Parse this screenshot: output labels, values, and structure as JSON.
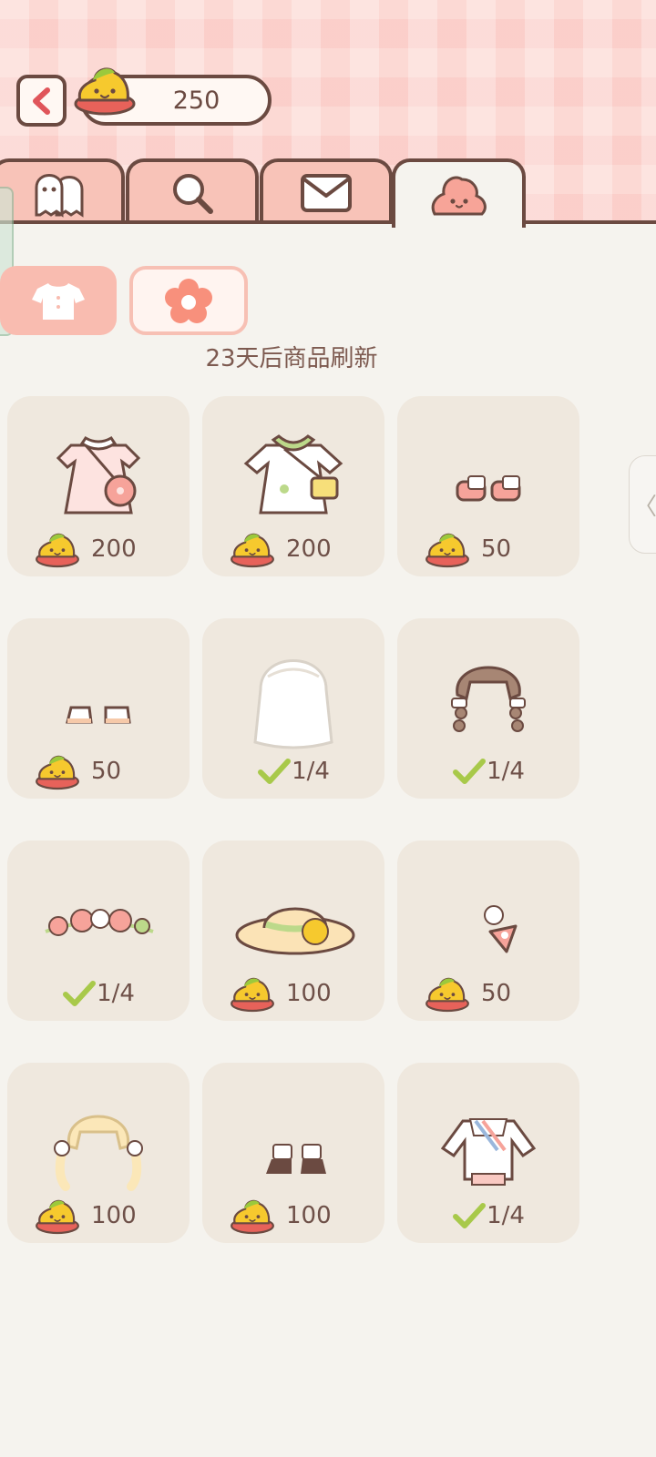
{
  "header": {
    "coin_count": "250",
    "back_icon": "back-arrow-icon",
    "currency_icon": "poop-coin-icon"
  },
  "tabs": [
    {
      "icon": "ghost-friends-icon",
      "active": false
    },
    {
      "icon": "magnifier-icon",
      "active": false
    },
    {
      "icon": "mail-icon",
      "active": false
    },
    {
      "icon": "pink-poop-icon",
      "active": true
    }
  ],
  "categories": [
    {
      "icon": "shirt-icon",
      "selected": true
    },
    {
      "icon": "flower-icon",
      "selected": false
    }
  ],
  "refresh_text": "23天后商品刷新",
  "items": [
    {
      "name": "pink-floral-dress",
      "label": "200",
      "owned": false
    },
    {
      "name": "green-dress-with-bag",
      "label": "200",
      "owned": false
    },
    {
      "name": "pink-socks",
      "label": "50",
      "owned": false
    },
    {
      "name": "white-shoes",
      "label": "50",
      "owned": false
    },
    {
      "name": "white-long-hair",
      "label": "1/4",
      "owned": true
    },
    {
      "name": "brown-braided-hair",
      "label": "1/4",
      "owned": true
    },
    {
      "name": "flower-crown",
      "label": "1/4",
      "owned": true
    },
    {
      "name": "straw-hat",
      "label": "100",
      "owned": false
    },
    {
      "name": "strawberry-hairpin",
      "label": "50",
      "owned": false
    },
    {
      "name": "blonde-pigtails",
      "label": "100",
      "owned": false
    },
    {
      "name": "brown-boots",
      "label": "100",
      "owned": false
    },
    {
      "name": "white-sailor-outfit",
      "label": "1/4",
      "owned": true
    }
  ],
  "colors": {
    "accent": "#f9bcb0",
    "outline": "#6b4a41",
    "card": "#efe8de",
    "check": "#a8c94a"
  }
}
